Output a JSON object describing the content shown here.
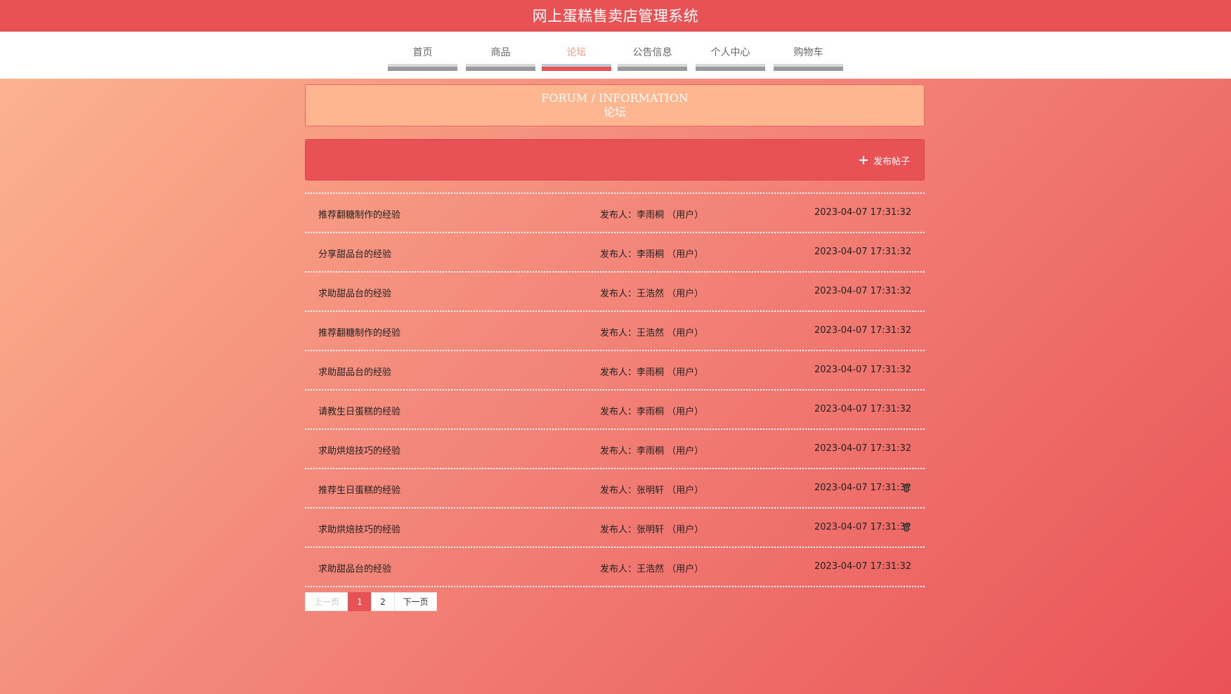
{
  "app": {
    "title": "网上蛋糕售卖店管理系统"
  },
  "nav": {
    "items": [
      {
        "label": "首页",
        "active": false
      },
      {
        "label": "商品",
        "active": false
      },
      {
        "label": "论坛",
        "active": true
      },
      {
        "label": "公告信息",
        "active": false
      },
      {
        "label": "个人中心",
        "active": false
      },
      {
        "label": "购物车",
        "active": false
      }
    ]
  },
  "header": {
    "title_en": "FORUM / INFORMATION",
    "title_cn": "论坛"
  },
  "actions": {
    "publish_label": "发布帖子",
    "publish_icon": "plus-icon"
  },
  "posts": [
    {
      "title": "推荐翻糖制作的经验",
      "author": "发布人：李雨桐 （用户）",
      "time": "2023-04-07 17:31:32",
      "deletable": false
    },
    {
      "title": "分享甜品台的经验",
      "author": "发布人：李雨桐 （用户）",
      "time": "2023-04-07 17:31:32",
      "deletable": false
    },
    {
      "title": "求助甜品台的经验",
      "author": "发布人：王浩然 （用户）",
      "time": "2023-04-07 17:31:32",
      "deletable": false
    },
    {
      "title": "推荐翻糖制作的经验",
      "author": "发布人：王浩然 （用户）",
      "time": "2023-04-07 17:31:32",
      "deletable": false
    },
    {
      "title": "求助甜品台的经验",
      "author": "发布人：李雨桐 （用户）",
      "time": "2023-04-07 17:31:32",
      "deletable": false
    },
    {
      "title": "请教生日蛋糕的经验",
      "author": "发布人：李雨桐 （用户）",
      "time": "2023-04-07 17:31:32",
      "deletable": false
    },
    {
      "title": "求助烘焙技巧的经验",
      "author": "发布人：李雨桐 （用户）",
      "time": "2023-04-07 17:31:32",
      "deletable": false
    },
    {
      "title": "推荐生日蛋糕的经验",
      "author": "发布人：张明轩 （用户）",
      "time": "2023-04-07 17:31:32",
      "deletable": true
    },
    {
      "title": "求助烘焙技巧的经验",
      "author": "发布人：张明轩 （用户）",
      "time": "2023-04-07 17:31:32",
      "deletable": true
    },
    {
      "title": "求助甜品台的经验",
      "author": "发布人：王浩然 （用户）",
      "time": "2023-04-07 17:31:32",
      "deletable": false
    }
  ],
  "pager": {
    "prev_label": "上一页",
    "pages": [
      "1",
      "2"
    ],
    "current": "1",
    "next_label": "下一页"
  },
  "colors": {
    "primary": "#e95255",
    "header_bg": "#fdb690",
    "active_nav_text": "#f59a86"
  }
}
